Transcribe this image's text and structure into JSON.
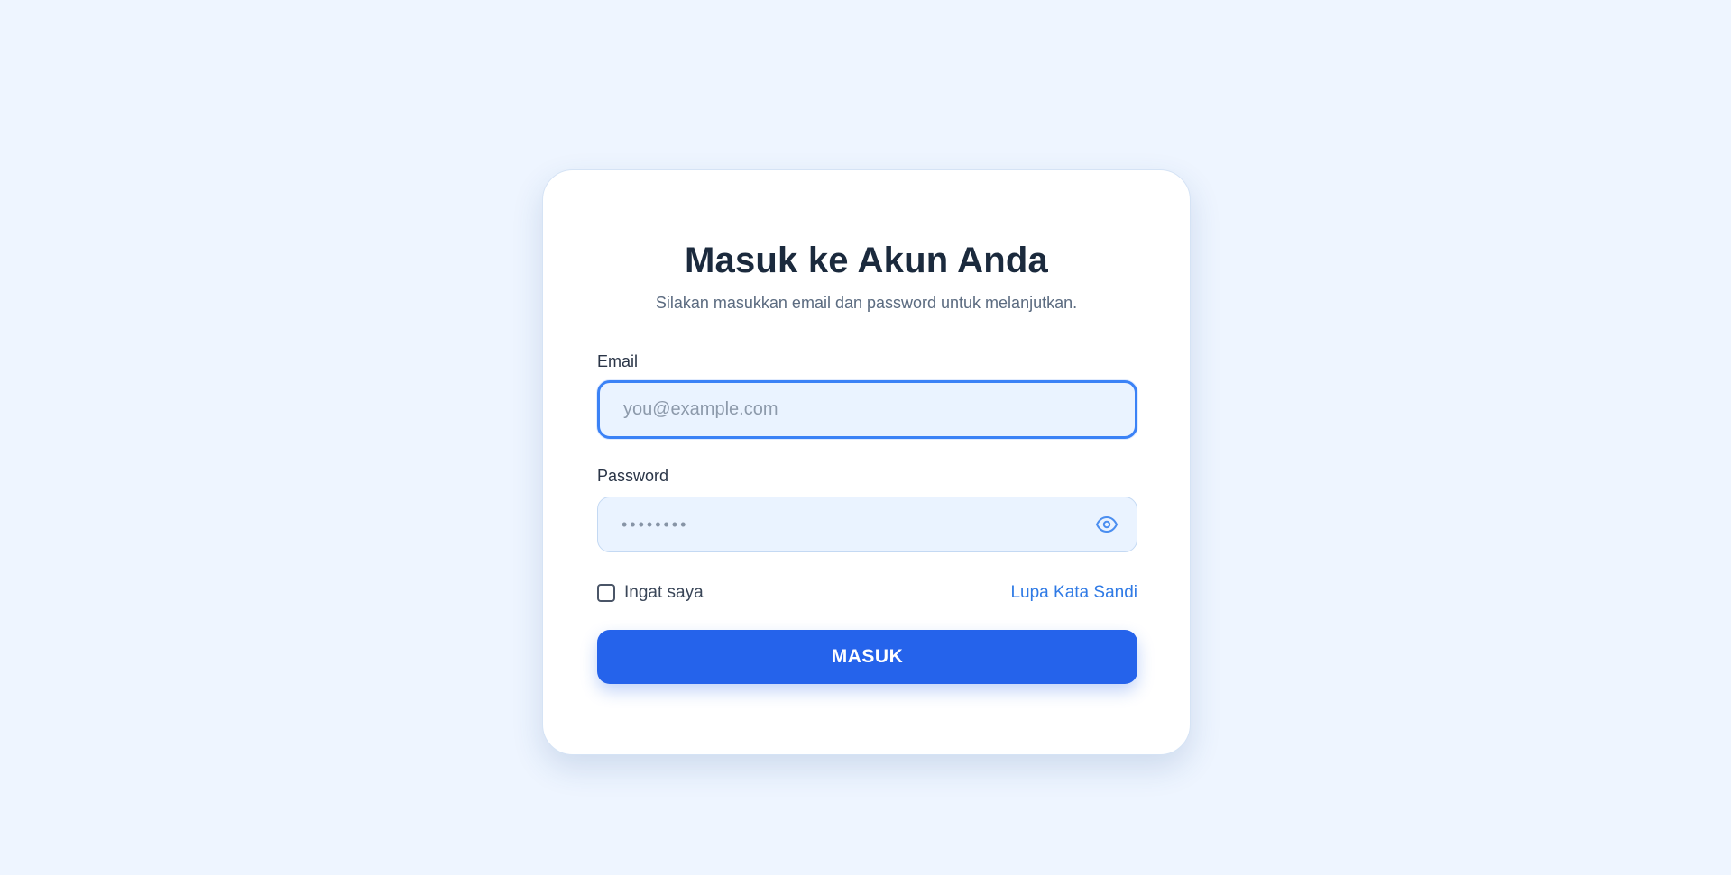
{
  "page": {
    "background_color": "#eef5ff",
    "accent_color": "#2563eb",
    "link_color": "#2f7ae5"
  },
  "login": {
    "title": "Masuk ke Akun Anda",
    "subtitle": "Silakan masukkan email dan password untuk melanjutkan.",
    "email": {
      "label": "Email",
      "value": "",
      "placeholder": "you@example.com"
    },
    "password": {
      "label": "Password",
      "value": "",
      "placeholder": "••••••••",
      "toggle_icon": "eye-icon"
    },
    "remember_me": {
      "label": "Ingat saya",
      "checked": false
    },
    "forgot_password_label": "Lupa Kata Sandi",
    "submit_label": "MASUK"
  }
}
